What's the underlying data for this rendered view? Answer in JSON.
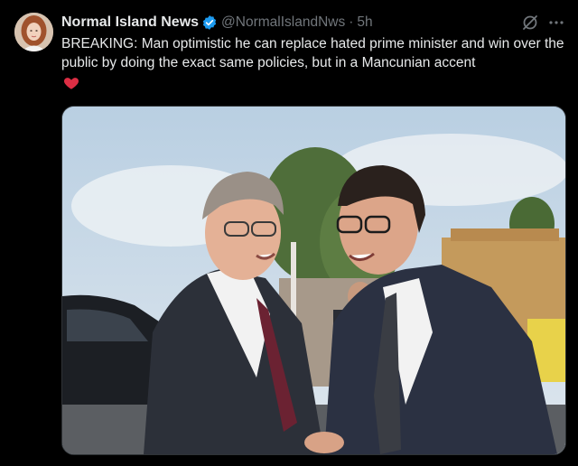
{
  "tweet": {
    "author_name": "Normal Island News",
    "handle": "@NormalIslandNws",
    "separator": "·",
    "timestamp": "5h",
    "text": "BREAKING: Man optimistic he can replace hated prime minister and win over the public by doing the exact same policies, but in a Mancunian accent",
    "emoji": "red-heart",
    "verified_color": "#1d9bf0",
    "heart_color": "#f91880"
  },
  "icons": {
    "grok": "grok-icon",
    "more": "more-options-icon"
  },
  "media": {
    "description_icon": "photo"
  }
}
